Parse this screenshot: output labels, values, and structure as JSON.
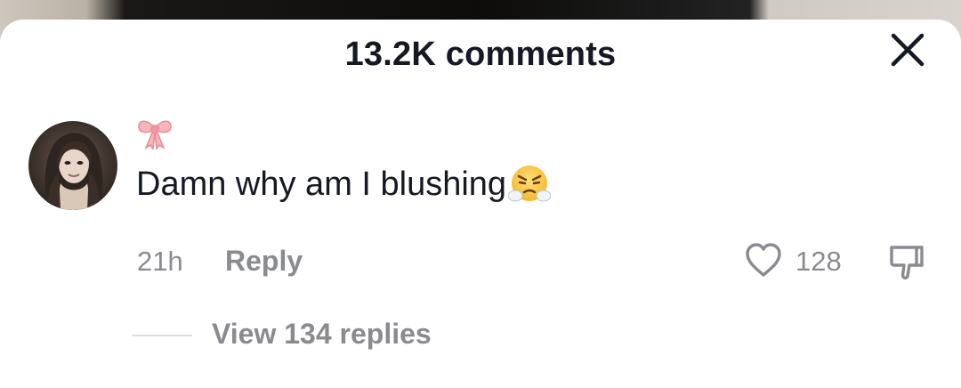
{
  "header": {
    "title": "13.2K comments",
    "close_icon": "close-icon"
  },
  "comment": {
    "avatar_icon": "user-avatar",
    "badge_icon": "ribbon-bow-icon",
    "text": "Damn why am I blushing",
    "emoji_icon": "face-with-steam-from-nose-emoji",
    "time": "21h",
    "reply_label": "Reply",
    "like_icon": "heart-outline-icon",
    "like_count": "128",
    "dislike_icon": "thumbs-down-icon"
  },
  "replies": {
    "label": "View 134 replies"
  },
  "colors": {
    "text_primary": "#161823",
    "text_secondary": "#8a8b91",
    "background": "#ffffff",
    "bow_pink": "#f4a0a8"
  }
}
